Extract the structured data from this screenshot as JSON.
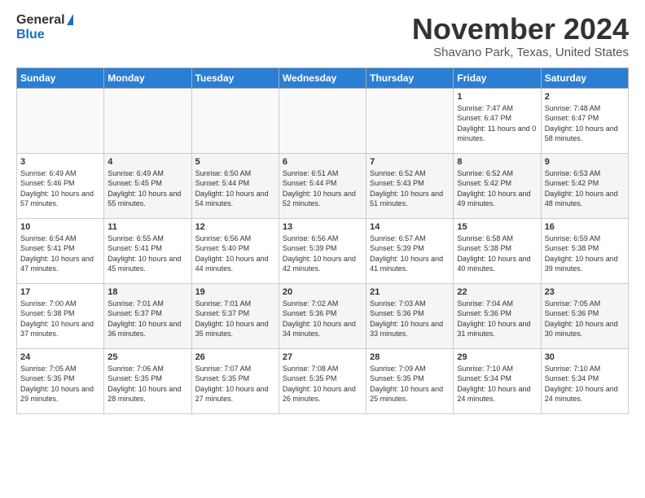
{
  "logo": {
    "general": "General",
    "blue": "Blue"
  },
  "header": {
    "month": "November 2024",
    "location": "Shavano Park, Texas, United States"
  },
  "weekdays": [
    "Sunday",
    "Monday",
    "Tuesday",
    "Wednesday",
    "Thursday",
    "Friday",
    "Saturday"
  ],
  "weeks": [
    [
      {
        "day": "",
        "info": ""
      },
      {
        "day": "",
        "info": ""
      },
      {
        "day": "",
        "info": ""
      },
      {
        "day": "",
        "info": ""
      },
      {
        "day": "",
        "info": ""
      },
      {
        "day": "1",
        "info": "Sunrise: 7:47 AM\nSunset: 6:47 PM\nDaylight: 11 hours and 0 minutes."
      },
      {
        "day": "2",
        "info": "Sunrise: 7:48 AM\nSunset: 6:47 PM\nDaylight: 10 hours and 58 minutes."
      }
    ],
    [
      {
        "day": "3",
        "info": "Sunrise: 6:49 AM\nSunset: 5:46 PM\nDaylight: 10 hours and 57 minutes."
      },
      {
        "day": "4",
        "info": "Sunrise: 6:49 AM\nSunset: 5:45 PM\nDaylight: 10 hours and 55 minutes."
      },
      {
        "day": "5",
        "info": "Sunrise: 6:50 AM\nSunset: 5:44 PM\nDaylight: 10 hours and 54 minutes."
      },
      {
        "day": "6",
        "info": "Sunrise: 6:51 AM\nSunset: 5:44 PM\nDaylight: 10 hours and 52 minutes."
      },
      {
        "day": "7",
        "info": "Sunrise: 6:52 AM\nSunset: 5:43 PM\nDaylight: 10 hours and 51 minutes."
      },
      {
        "day": "8",
        "info": "Sunrise: 6:52 AM\nSunset: 5:42 PM\nDaylight: 10 hours and 49 minutes."
      },
      {
        "day": "9",
        "info": "Sunrise: 6:53 AM\nSunset: 5:42 PM\nDaylight: 10 hours and 48 minutes."
      }
    ],
    [
      {
        "day": "10",
        "info": "Sunrise: 6:54 AM\nSunset: 5:41 PM\nDaylight: 10 hours and 47 minutes."
      },
      {
        "day": "11",
        "info": "Sunrise: 6:55 AM\nSunset: 5:41 PM\nDaylight: 10 hours and 45 minutes."
      },
      {
        "day": "12",
        "info": "Sunrise: 6:56 AM\nSunset: 5:40 PM\nDaylight: 10 hours and 44 minutes."
      },
      {
        "day": "13",
        "info": "Sunrise: 6:56 AM\nSunset: 5:39 PM\nDaylight: 10 hours and 42 minutes."
      },
      {
        "day": "14",
        "info": "Sunrise: 6:57 AM\nSunset: 5:39 PM\nDaylight: 10 hours and 41 minutes."
      },
      {
        "day": "15",
        "info": "Sunrise: 6:58 AM\nSunset: 5:38 PM\nDaylight: 10 hours and 40 minutes."
      },
      {
        "day": "16",
        "info": "Sunrise: 6:59 AM\nSunset: 5:38 PM\nDaylight: 10 hours and 39 minutes."
      }
    ],
    [
      {
        "day": "17",
        "info": "Sunrise: 7:00 AM\nSunset: 5:38 PM\nDaylight: 10 hours and 37 minutes."
      },
      {
        "day": "18",
        "info": "Sunrise: 7:01 AM\nSunset: 5:37 PM\nDaylight: 10 hours and 36 minutes."
      },
      {
        "day": "19",
        "info": "Sunrise: 7:01 AM\nSunset: 5:37 PM\nDaylight: 10 hours and 35 minutes."
      },
      {
        "day": "20",
        "info": "Sunrise: 7:02 AM\nSunset: 5:36 PM\nDaylight: 10 hours and 34 minutes."
      },
      {
        "day": "21",
        "info": "Sunrise: 7:03 AM\nSunset: 5:36 PM\nDaylight: 10 hours and 33 minutes."
      },
      {
        "day": "22",
        "info": "Sunrise: 7:04 AM\nSunset: 5:36 PM\nDaylight: 10 hours and 31 minutes."
      },
      {
        "day": "23",
        "info": "Sunrise: 7:05 AM\nSunset: 5:36 PM\nDaylight: 10 hours and 30 minutes."
      }
    ],
    [
      {
        "day": "24",
        "info": "Sunrise: 7:05 AM\nSunset: 5:35 PM\nDaylight: 10 hours and 29 minutes."
      },
      {
        "day": "25",
        "info": "Sunrise: 7:06 AM\nSunset: 5:35 PM\nDaylight: 10 hours and 28 minutes."
      },
      {
        "day": "26",
        "info": "Sunrise: 7:07 AM\nSunset: 5:35 PM\nDaylight: 10 hours and 27 minutes."
      },
      {
        "day": "27",
        "info": "Sunrise: 7:08 AM\nSunset: 5:35 PM\nDaylight: 10 hours and 26 minutes."
      },
      {
        "day": "28",
        "info": "Sunrise: 7:09 AM\nSunset: 5:35 PM\nDaylight: 10 hours and 25 minutes."
      },
      {
        "day": "29",
        "info": "Sunrise: 7:10 AM\nSunset: 5:34 PM\nDaylight: 10 hours and 24 minutes."
      },
      {
        "day": "30",
        "info": "Sunrise: 7:10 AM\nSunset: 5:34 PM\nDaylight: 10 hours and 24 minutes."
      }
    ]
  ]
}
